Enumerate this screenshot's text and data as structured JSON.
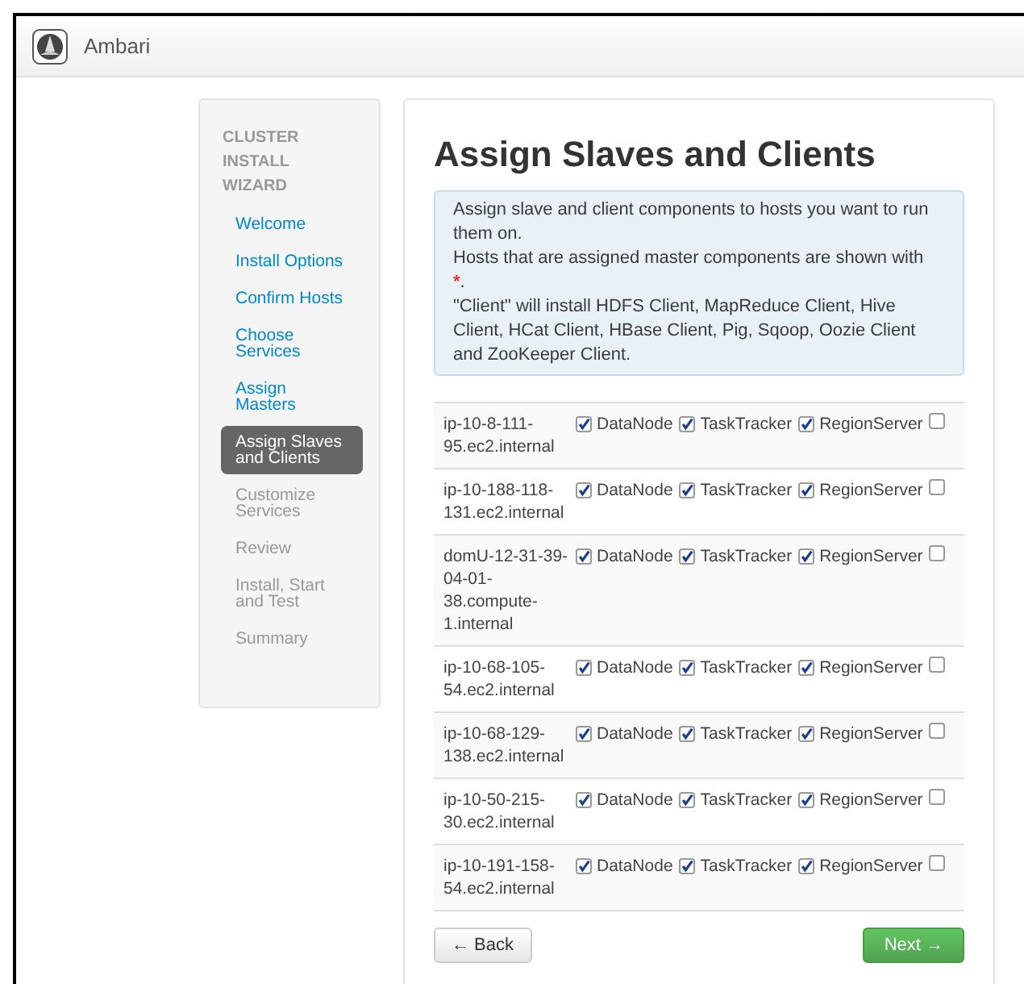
{
  "app": {
    "title": "Ambari"
  },
  "sidebar": {
    "heading": "CLUSTER INSTALL WIZARD",
    "items": [
      {
        "label": "Welcome",
        "disabled": false,
        "selected": false
      },
      {
        "label": "Install Options",
        "disabled": false,
        "selected": false
      },
      {
        "label": "Confirm Hosts",
        "disabled": false,
        "selected": false
      },
      {
        "label": "Choose Services",
        "disabled": false,
        "selected": false
      },
      {
        "label": "Assign Masters",
        "disabled": false,
        "selected": false
      },
      {
        "label": "Assign Slaves and Clients",
        "disabled": false,
        "selected": true
      },
      {
        "label": "Customize Services",
        "disabled": true,
        "selected": false
      },
      {
        "label": "Review",
        "disabled": true,
        "selected": false
      },
      {
        "label": "Install, Start and Test",
        "disabled": true,
        "selected": false
      },
      {
        "label": "Summary",
        "disabled": true,
        "selected": false
      }
    ]
  },
  "page_title": "Assign Slaves and Clients",
  "info": {
    "line_1": "Assign slave and client components to hosts you want to run them on.",
    "line_2": "Hosts that are assigned master components are shown with",
    "marker": "*",
    "marker_end": ".",
    "line_3": "\"Client\" will install HDFS Client, MapReduce Client, Hive Client, HCat Client, HBase Client, Pig, Sqoop, Oozie Client and ZooKeeper Client."
  },
  "hosts": [
    {
      "name": "ip-10-8-111-95.ec2.internal",
      "components": [
        {
          "label": "DataNode",
          "checked": true
        },
        {
          "label": "TaskTracker",
          "checked": true
        },
        {
          "label": "RegionServer",
          "checked": true
        },
        {
          "checked": false
        }
      ]
    },
    {
      "name": "ip-10-188-118-131.ec2.internal",
      "components": [
        {
          "label": "DataNode",
          "checked": true
        },
        {
          "label": "TaskTracker",
          "checked": true
        },
        {
          "label": "RegionServer",
          "checked": true
        },
        {
          "checked": false
        }
      ]
    },
    {
      "name": "domU-12-31-39-04-01-38.compute-1.internal",
      "components": [
        {
          "label": "DataNode",
          "checked": true
        },
        {
          "label": "TaskTracker",
          "checked": true
        },
        {
          "label": "RegionServer",
          "checked": true
        },
        {
          "checked": false
        }
      ]
    },
    {
      "name": "ip-10-68-105-54.ec2.internal",
      "components": [
        {
          "label": "DataNode",
          "checked": true
        },
        {
          "label": "TaskTracker",
          "checked": true
        },
        {
          "label": "RegionServer",
          "checked": true
        },
        {
          "checked": false
        }
      ]
    },
    {
      "name": "ip-10-68-129-138.ec2.internal",
      "components": [
        {
          "label": "DataNode",
          "checked": true
        },
        {
          "label": "TaskTracker",
          "checked": true
        },
        {
          "label": "RegionServer",
          "checked": true
        },
        {
          "checked": false
        }
      ]
    },
    {
      "name": "ip-10-50-215-30.ec2.internal",
      "components": [
        {
          "label": "DataNode",
          "checked": true
        },
        {
          "label": "TaskTracker",
          "checked": true
        },
        {
          "label": "RegionServer",
          "checked": true
        },
        {
          "checked": false
        }
      ]
    },
    {
      "name": "ip-10-191-158-54.ec2.internal",
      "components": [
        {
          "label": "DataNode",
          "checked": true
        },
        {
          "label": "TaskTracker",
          "checked": true
        },
        {
          "label": "RegionServer",
          "checked": true
        },
        {
          "checked": false
        }
      ]
    }
  ],
  "buttons": {
    "back": "← Back",
    "next": "Next →"
  }
}
